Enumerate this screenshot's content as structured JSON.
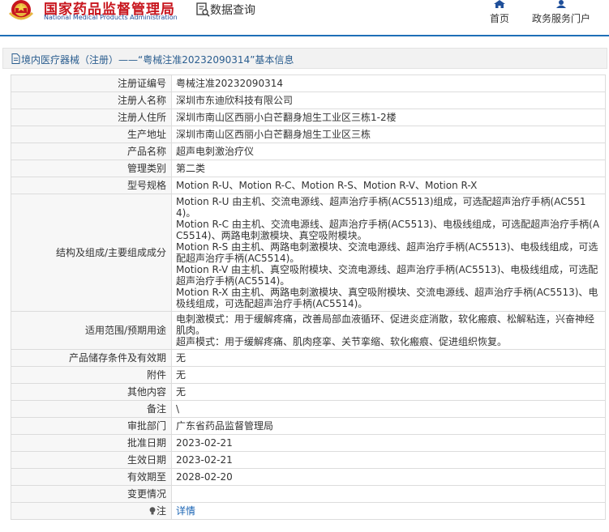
{
  "header": {
    "site_title": "国家药品监督管理局",
    "site_subtitle": "National Medical Products Administration",
    "section_label": "数据查询",
    "nav": [
      {
        "label": "首页",
        "icon": "home-icon"
      },
      {
        "label": "政务服务门户",
        "icon": "user-icon"
      }
    ],
    "accent_color": "#1f6fb8",
    "brand_color": "#c8161e"
  },
  "breadcrumb": {
    "text": "境内医疗器械（注册）——“粤械注准20232090314”基本信息",
    "icon": "document-icon"
  },
  "rows": [
    {
      "key": "注册证编号",
      "value": "粤械注准20232090314"
    },
    {
      "key": "注册人名称",
      "value": "深圳市东迪欣科技有限公司"
    },
    {
      "key": "注册人住所",
      "value": "深圳市南山区西丽小白芒翻身旭生工业区三栋1-2楼"
    },
    {
      "key": "生产地址",
      "value": "深圳市南山区西丽小白芒翻身旭生工业区三栋"
    },
    {
      "key": "产品名称",
      "value": "超声电刺激治疗仪"
    },
    {
      "key": "管理类别",
      "value": "第二类"
    },
    {
      "key": "型号规格",
      "value": "Motion R-U、Motion R-C、Motion R-S、Motion R-V、Motion R-X"
    },
    {
      "key": "结构及组成/主要组成成分",
      "value": "Motion R-U 由主机、交流电源线、超声治疗手柄(AC5513)组成，可选配超声治疗手柄(AC5514)。\nMotion R-C 由主机、交流电源线、超声治疗手柄(AC5513)、电极线组成，可选配超声治疗手柄(AC5514)、两路电刺激模块、真空吸附模块。\nMotion R-S 由主机、两路电刺激模块、交流电源线、超声治疗手柄(AC5513)、电极线组成，可选配超声治疗手柄(AC5514)。\nMotion R-V 由主机、真空吸附模块、交流电源线、超声治疗手柄(AC5513)、电极线组成，可选配超声治疗手柄(AC5514)。\nMotion R-X 由主机、两路电刺激模块、真空吸附模块、交流电源线、超声治疗手柄(AC5513)、电极线组成，可选配超声治疗手柄(AC5514)。"
    },
    {
      "key": "适用范围/预期用途",
      "value": "电刺激模式：用于缓解疼痛，改善局部血液循环、促进炎症消散，软化瘢痕、松解粘连，兴奋神经肌肉。\n超声模式：用于缓解疼痛、肌肉痉挛、关节挛缩、软化瘢痕、促进组织恢复。"
    },
    {
      "key": "产品储存条件及有效期",
      "value": "无"
    },
    {
      "key": "附件",
      "value": "无"
    },
    {
      "key": "其他内容",
      "value": "无"
    },
    {
      "key": "备注",
      "value": "\\"
    },
    {
      "key": "审批部门",
      "value": "广东省药品监督管理局"
    },
    {
      "key": "批准日期",
      "value": "2023-02-21"
    },
    {
      "key": "生效日期",
      "value": "2023-02-21"
    },
    {
      "key": "有效期至",
      "value": "2028-02-20"
    },
    {
      "key": "变更情况",
      "value": ""
    }
  ],
  "note_row": {
    "key": "注",
    "icon": "lightbulb-icon",
    "link_label": "详情"
  }
}
